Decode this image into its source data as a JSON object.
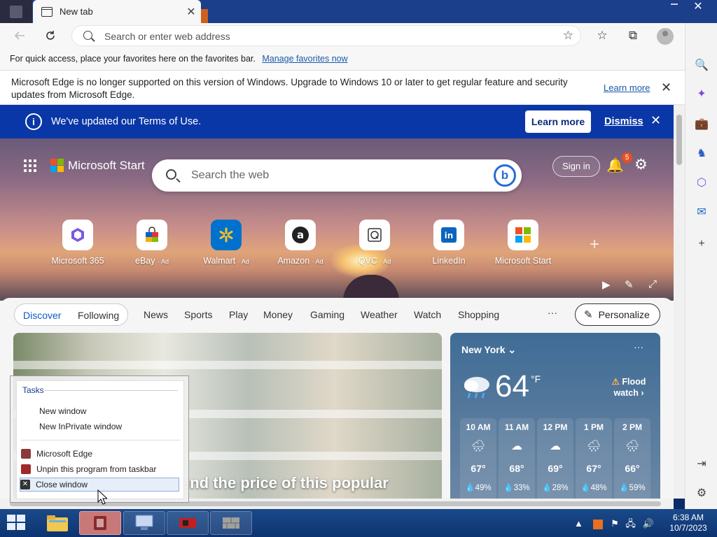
{
  "browser": {
    "tab_title": "New tab",
    "tab_close": "✕",
    "window_close": "✕",
    "address_placeholder": "Search or enter web address",
    "favbar_text": "For quick access, place your favorites here on the favorites bar.",
    "favbar_link": "Manage favorites now",
    "infobar_text": "Microsoft Edge is no longer supported on this version of Windows. Upgrade to Windows 10 or later to get regular feature and security updates from Microsoft Edge.",
    "infobar_link": "Learn more",
    "infobar_close": "✕"
  },
  "terms": {
    "text": "We've updated our Terms of Use.",
    "learn_more": "Learn more",
    "dismiss": "Dismiss",
    "close": "✕",
    "info_glyph": "i"
  },
  "start": {
    "brand": "Microsoft Start",
    "search_placeholder": "Search the web",
    "bing_glyph": "b",
    "sign_in": "Sign in",
    "notification_count": "5",
    "tiles": [
      {
        "name": "Microsoft 365",
        "ad": ""
      },
      {
        "name": "eBay",
        "ad": "· Ad"
      },
      {
        "name": "Walmart",
        "ad": "· Ad"
      },
      {
        "name": "Amazon",
        "ad": "· Ad"
      },
      {
        "name": "QVC",
        "ad": "· Ad"
      },
      {
        "name": "LinkedIn",
        "ad": ""
      },
      {
        "name": "Microsoft Start",
        "ad": ""
      }
    ],
    "add_tile": "+"
  },
  "feed": {
    "tabs": [
      "Discover",
      "Following"
    ],
    "nav": [
      "News",
      "Sports",
      "Play",
      "Money",
      "Gaming",
      "Weather",
      "Watch",
      "Shopping"
    ],
    "more": "···",
    "personalize": "Personalize",
    "headline": "end the price of this popular"
  },
  "weather": {
    "city": "New York",
    "more": "···",
    "temp": "64",
    "unit": "°F",
    "alert": "Flood watch",
    "hours": [
      {
        "time": "10 AM",
        "temp": "67°",
        "precip": "49%"
      },
      {
        "time": "11 AM",
        "temp": "68°",
        "precip": "33%"
      },
      {
        "time": "12 PM",
        "temp": "69°",
        "precip": "28%"
      },
      {
        "time": "1 PM",
        "temp": "67°",
        "precip": "48%"
      },
      {
        "time": "2 PM",
        "temp": "66°",
        "precip": "59%"
      }
    ]
  },
  "jumplist": {
    "heading": "Tasks",
    "tasks": [
      "New window",
      "New InPrivate window"
    ],
    "pinned": [
      "Microsoft Edge",
      "Unpin this program from taskbar",
      "Close window"
    ]
  },
  "taskbar": {
    "time": "6:38 AM",
    "date": "10/7/2023"
  },
  "colors": {
    "terms_bar": "#0a37a7",
    "link": "#1a5aa8",
    "accent": "#0a5ac8"
  }
}
